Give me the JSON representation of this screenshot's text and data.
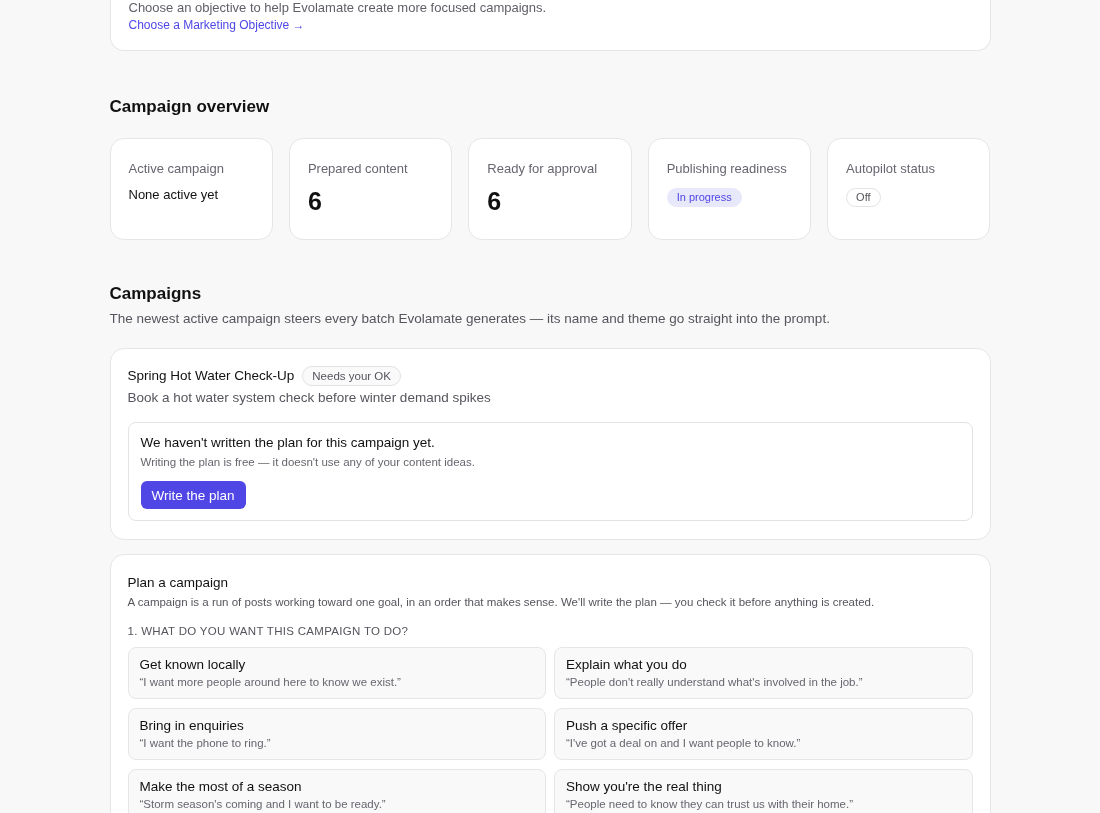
{
  "objective_card": {
    "hint": "Choose an objective to help Evolamate create more focused campaigns.",
    "link": "Choose a Marketing Objective →"
  },
  "overview": {
    "title": "Campaign overview",
    "cards": [
      {
        "label": "Active campaign",
        "kind": "text",
        "value": "None active yet"
      },
      {
        "label": "Prepared content",
        "kind": "number",
        "value": "6"
      },
      {
        "label": "Ready for approval",
        "kind": "number",
        "value": "6"
      },
      {
        "label": "Publishing readiness",
        "kind": "badge",
        "value": "In progress"
      },
      {
        "label": "Autopilot status",
        "kind": "pill",
        "value": "Off"
      }
    ]
  },
  "campaigns": {
    "title": "Campaigns",
    "description": "The newest active campaign steers every batch Evolamate generates — its name and theme go straight into the prompt.",
    "items": [
      {
        "name": "Spring Hot Water Check-Up",
        "status": "Needs your OK",
        "goal": "Book a hot water system check before winter demand spikes",
        "plan_notice": {
          "title": "We haven't written the plan for this campaign yet.",
          "note": "Writing the plan is free — it doesn't use any of your content ideas.",
          "button": "Write the plan"
        }
      }
    ]
  },
  "plan_form": {
    "title": "Plan a campaign",
    "description": "A campaign is a run of posts working toward one goal, in an order that makes sense. We'll write the plan — you check it before anything is created.",
    "question": "1. WHAT DO YOU WANT THIS CAMPAIGN TO DO?",
    "options": [
      {
        "title": "Get known locally",
        "quote": "“I want more people around here to know we exist.”",
        "selected": false
      },
      {
        "title": "Explain what you do",
        "quote": "“People don't really understand what's involved in the job.”",
        "selected": false
      },
      {
        "title": "Bring in enquiries",
        "quote": "“I want the phone to ring.”",
        "selected": false
      },
      {
        "title": "Push a specific offer",
        "quote": "“I've got a deal on and I want people to know.”",
        "selected": false
      },
      {
        "title": "Make the most of a season",
        "quote": "“Storm season's coming and I want to be ready.”",
        "selected": false
      },
      {
        "title": "Show you're the real thing",
        "quote": "“People need to know they can trust us with their home.”",
        "selected": false
      }
    ]
  }
}
